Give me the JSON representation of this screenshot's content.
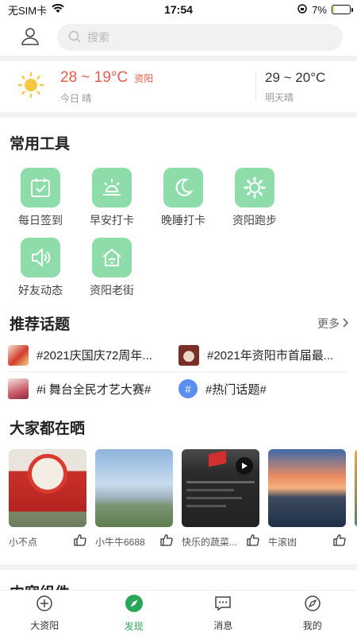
{
  "status_bar": {
    "carrier": "无SIM卡",
    "time": "17:54",
    "battery": "7%",
    "battery_level": 0.07
  },
  "search": {
    "placeholder": "搜索"
  },
  "weather": {
    "today_temp": "28 ~ 19°C",
    "city": "资阳",
    "today_label": "今日 晴",
    "tomorrow_temp": "29 ~ 20°C",
    "tomorrow_label": "明天晴"
  },
  "tools": {
    "title": "常用工具",
    "items": [
      {
        "label": "每日签到",
        "icon": "calendar-check-icon"
      },
      {
        "label": "早安打卡",
        "icon": "sunrise-icon"
      },
      {
        "label": "晚睡打卡",
        "icon": "moon-stars-icon"
      },
      {
        "label": "资阳跑步",
        "icon": "gear-icon"
      },
      {
        "label": "好友动态",
        "icon": "speaker-icon"
      },
      {
        "label": "资阳老街",
        "icon": "home-wifi-icon"
      }
    ]
  },
  "topics": {
    "title": "推荐话题",
    "more": "更多",
    "items": [
      {
        "text": "#2021庆国庆72周年..."
      },
      {
        "text": "#2021年资阳市首届最..."
      },
      {
        "text": "#i 舞台全民才艺大赛#"
      },
      {
        "text": "#热门话题#"
      }
    ]
  },
  "shares": {
    "title": "大家都在晒",
    "items": [
      {
        "user": "小不点"
      },
      {
        "user": "小牛牛6688"
      },
      {
        "user": "快乐的蔬菜..."
      },
      {
        "user": "牛滚凼"
      }
    ]
  },
  "components": {
    "title": "内容组件"
  },
  "tabs": [
    {
      "label": "大资阳",
      "icon": "plus-circle-icon"
    },
    {
      "label": "发现",
      "icon": "compass-icon",
      "active": true
    },
    {
      "label": "消息",
      "icon": "message-icon"
    },
    {
      "label": "我的",
      "icon": "compass-outline-icon"
    }
  ],
  "colors": {
    "accent": "#2aa65a",
    "tool_bg": "#8ddcaa",
    "temp_red": "#e35c4e"
  }
}
